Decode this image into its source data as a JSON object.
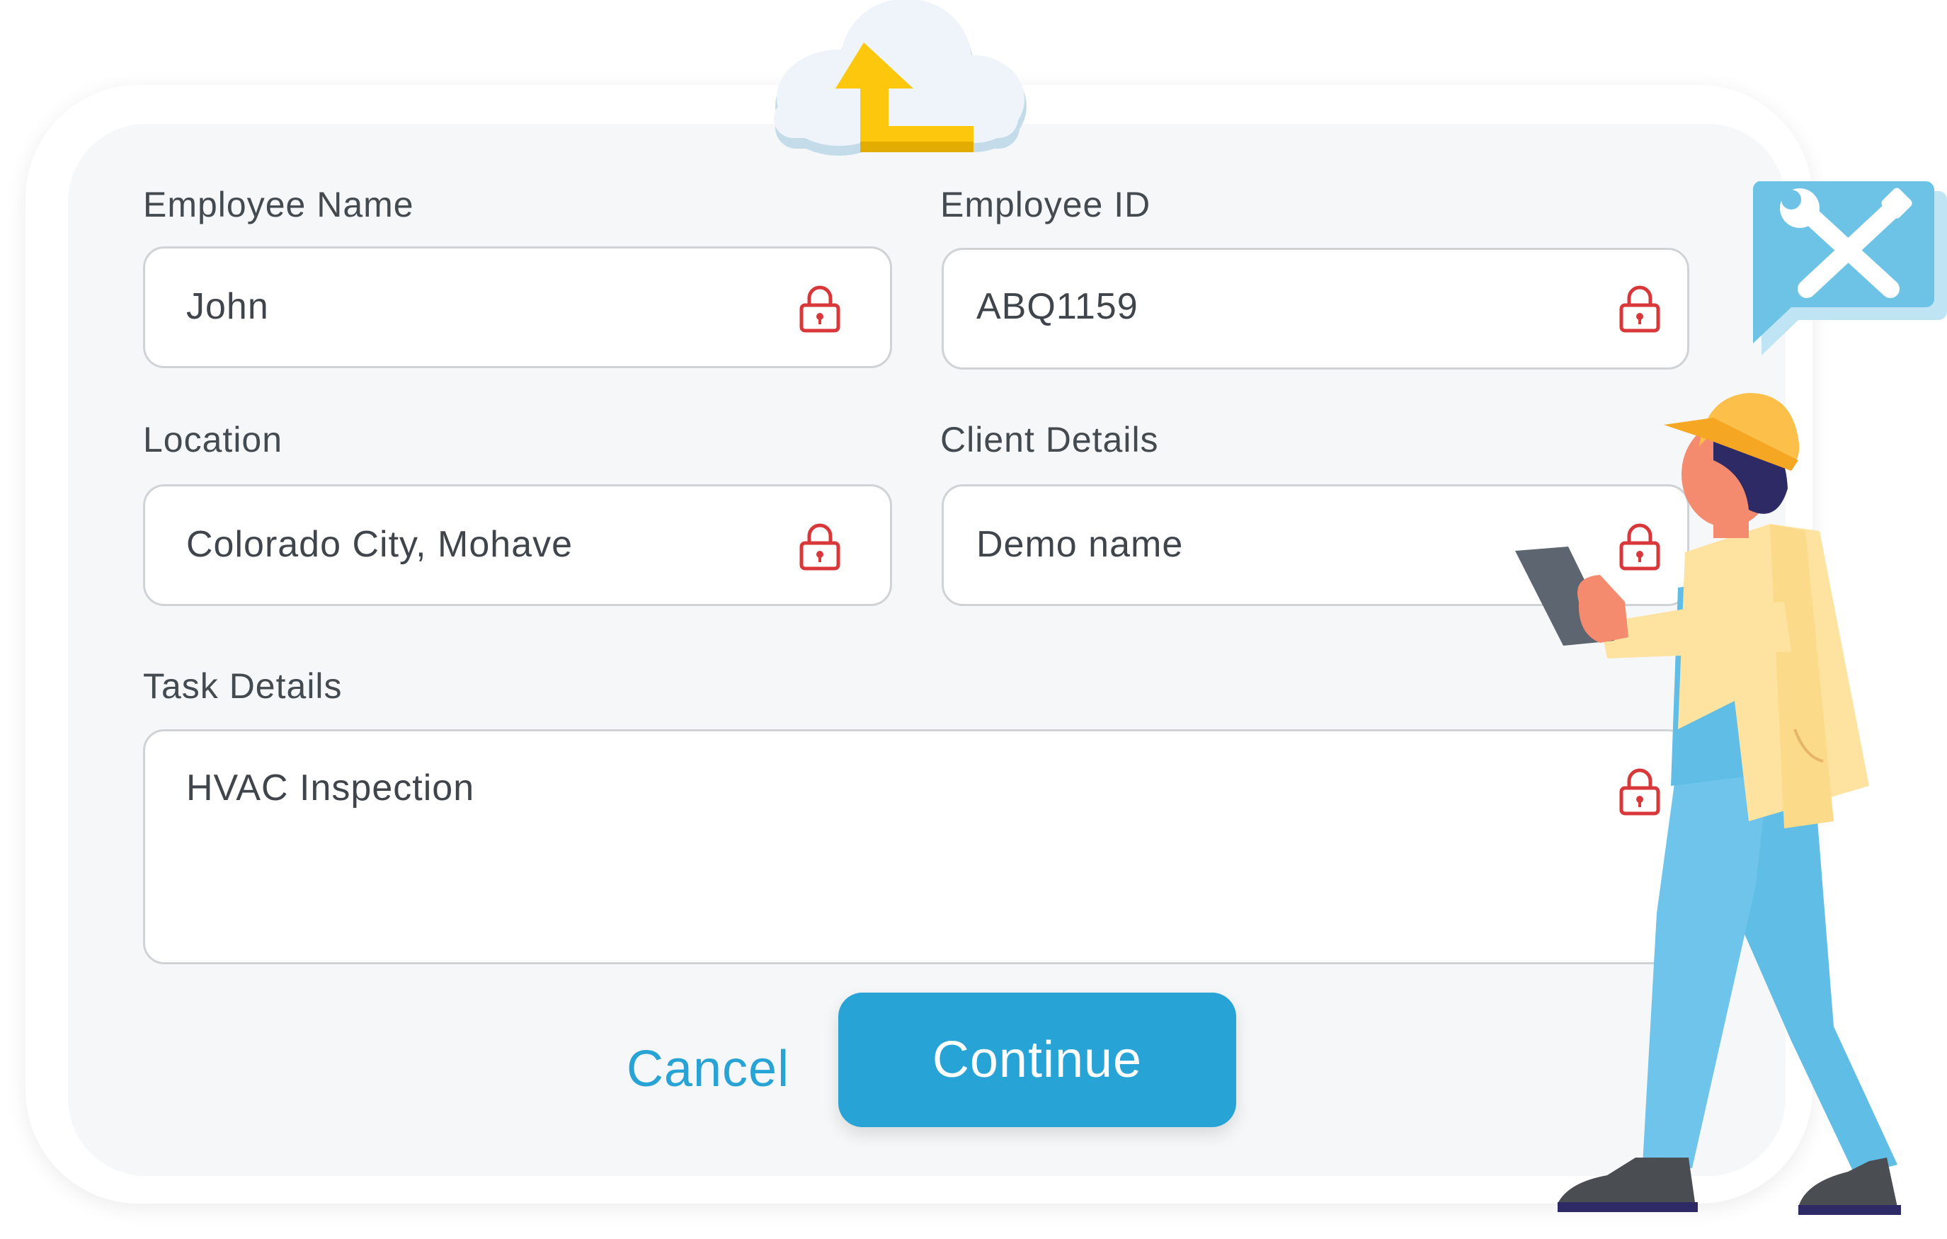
{
  "form": {
    "employee_name": {
      "label": "Employee Name",
      "value": "John"
    },
    "employee_id": {
      "label": "Employee ID",
      "value": "ABQ1159"
    },
    "location": {
      "label": "Location",
      "value": "Colorado City, Mohave"
    },
    "client_details": {
      "label": "Client Details",
      "value": "Demo name"
    },
    "task_details": {
      "label": "Task Details",
      "value": "HVAC Inspection"
    }
  },
  "actions": {
    "cancel_label": "Cancel",
    "continue_label": "Continue"
  },
  "icons": {
    "field_lock": "lock-icon",
    "upload": "cloud-upload-icon",
    "tools": "tools-icon"
  },
  "colors": {
    "accent": "#27a3d6",
    "lock": "#d9383a",
    "panel_bg": "#f6f7f8",
    "upload_arrow": "#fcc70d",
    "tool_bubble": "#6cc3e6"
  }
}
